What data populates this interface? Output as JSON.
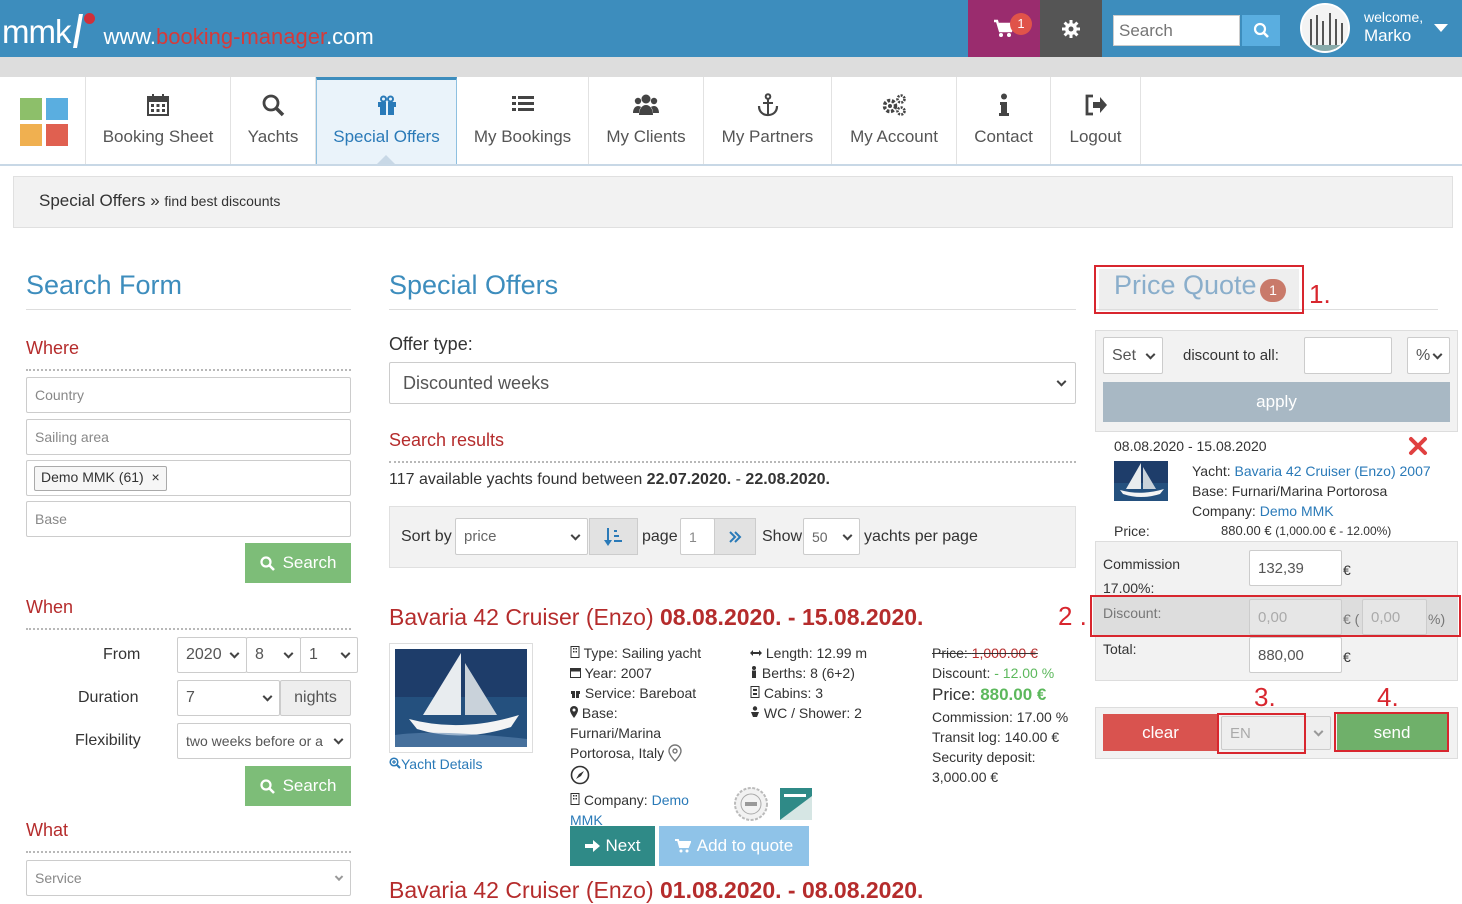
{
  "header": {
    "logo_text": "mmk",
    "logo_url_prefix": "www.",
    "logo_url_brand": "booking-manager",
    "logo_url_suffix": ".com",
    "cart_count": "1",
    "search_placeholder": "Search",
    "welcome_label": "welcome,",
    "user_name": "Marko"
  },
  "nav": {
    "items": [
      {
        "label": "Booking Sheet",
        "icon": "calendar-icon"
      },
      {
        "label": "Yachts",
        "icon": "search-icon"
      },
      {
        "label": "Special Offers",
        "icon": "gift-icon",
        "active": true
      },
      {
        "label": "My Bookings",
        "icon": "list-icon"
      },
      {
        "label": "My Clients",
        "icon": "users-icon"
      },
      {
        "label": "My Partners",
        "icon": "anchor-icon"
      },
      {
        "label": "My Account",
        "icon": "cogs-icon"
      },
      {
        "label": "Contact",
        "icon": "info-icon"
      },
      {
        "label": "Logout",
        "icon": "logout-icon"
      }
    ]
  },
  "breadcrumb": {
    "title": "Special Offers",
    "separator": "»",
    "subtitle": "find best discounts"
  },
  "search_form": {
    "title": "Search Form",
    "where_label": "Where",
    "country_placeholder": "Country",
    "sailing_area_placeholder": "Sailing area",
    "company_tag": "Demo MMK (61)",
    "tag_remove": "×",
    "base_placeholder": "Base",
    "search_label": "Search",
    "when_label": "When",
    "from_label": "From",
    "from_year": "2020",
    "from_month": "8",
    "from_day": "1",
    "duration_label": "Duration",
    "duration_value": "7",
    "nights_label": "nights",
    "flexibility_label": "Flexibility",
    "flexibility_value": "two weeks before or a",
    "what_label": "What",
    "service_placeholder": "Service"
  },
  "offers": {
    "title": "Special Offers",
    "offer_type_label": "Offer type:",
    "offer_type_value": "Discounted weeks",
    "results_label": "Search results",
    "found_text": "117 available yachts found between ",
    "date_from": "22.07.2020.",
    "dash": " - ",
    "date_to": "22.08.2020.",
    "sort_label": "Sort by",
    "sort_value": "price",
    "page_label": "page",
    "page_value": "1",
    "show_label": "Show",
    "show_value": "50",
    "per_page_label": "yachts per page"
  },
  "result1": {
    "name": "Bavaria 42 Cruiser (Enzo) ",
    "dates": "08.08.2020. - 15.08.2020.",
    "details_link": "Yacht Details",
    "type": "Type: Sailing yacht",
    "year": "Year: 2007",
    "service": "Service: Bareboat",
    "base_label": "Base:",
    "base_value_1": "Furnari/Marina",
    "base_value_2": "Portorosa,  Italy",
    "company_label": "Company: ",
    "company_value_1": "Demo",
    "company_value_2": "MMK",
    "length": "Length: 12.99 m",
    "berths": "Berths: 8 (6+2)",
    "cabins": "Cabins: 3",
    "wc": "WC / Shower: 2",
    "old_price_label": "Price: ",
    "old_price": "1,000.00 €",
    "discount_label": "Discount: ",
    "discount_value": "- 12.00 %",
    "price_label": "Price: ",
    "price_value": "880.00 €",
    "commission": "Commission: 17.00 %",
    "transit": "Transit log: 140.00 €",
    "deposit_label": "Security deposit:",
    "deposit_value": "3,000.00 €",
    "next_label": "Next",
    "add_quote_label": "Add to quote"
  },
  "result2": {
    "name": "Bavaria 42 Cruiser (Enzo) ",
    "dates": "01.08.2020. - 08.08.2020."
  },
  "quote": {
    "title": "Price Quote",
    "count": "1",
    "set_value": "Set",
    "discount_all_label": "discount to all:",
    "unit_value": "%",
    "apply_label": "apply",
    "item_dates": "08.08.2020 - 15.08.2020",
    "yacht_label": "Yacht: ",
    "yacht_value": "Bavaria 42 Cruiser (Enzo) 2007",
    "base_text": "Base: Furnari/Marina Portorosa",
    "company_label": "Company: ",
    "company_value": "Demo MMK",
    "price_label": "Price:",
    "price_value": "880.00 € ",
    "price_detail": "(1,000.00 € - 12.00%)",
    "commission_label_1": "Commission",
    "commission_label_2": "17.00%:",
    "commission_value": "132,39",
    "euro": "€",
    "discount_label": "Discount:",
    "discount_value": "0,00",
    "discount_mid": "€ (",
    "discount_pct": "0,00",
    "discount_end": "%)",
    "total_label": "Total:",
    "total_value": "880,00",
    "clear_label": "clear",
    "lang_value": "EN",
    "send_label": "send"
  },
  "annotations": [
    "1.",
    "2 .",
    "3.",
    "4."
  ],
  "colors": {
    "primary": "#3d8dbd",
    "accent_red": "#b52c2c",
    "green": "#7dbd78",
    "cart": "#9a2c6e"
  }
}
